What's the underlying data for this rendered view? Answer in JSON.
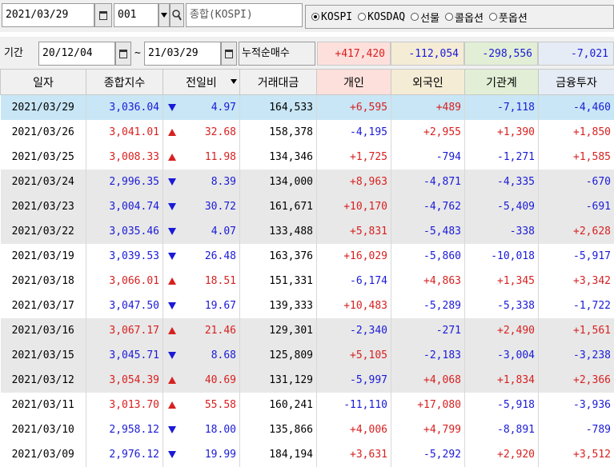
{
  "toolbar": {
    "date": "2021/03/29",
    "code": "001",
    "name": "종합(KOSPI)",
    "radios": [
      {
        "label": "KOSPI",
        "checked": true
      },
      {
        "label": "KOSDAQ",
        "checked": false
      },
      {
        "label": "선물",
        "checked": false
      },
      {
        "label": "콜옵션",
        "checked": false
      },
      {
        "label": "풋옵션",
        "checked": false
      }
    ]
  },
  "period": {
    "label": "기간",
    "from": "20/12/04",
    "tilde": "~",
    "to": "21/03/29",
    "cumulative_label": "누적순매수",
    "sums": {
      "individual": "+417,420",
      "foreign": "-112,054",
      "institution": "-298,556",
      "financial": "-7,021"
    }
  },
  "colors": {
    "up": "#d82020",
    "down": "#1a1ad8",
    "individual_bg": "#fde0dc",
    "foreign_bg": "#f5ecd6",
    "institution_bg": "#e2efd6",
    "financial_bg": "#e6ecf5",
    "selected": "#c8e6f5"
  },
  "columns": [
    "일자",
    "종합지수",
    "전일비",
    "거래대금",
    "개인",
    "외국인",
    "기관계",
    "금융투자"
  ],
  "rows": [
    {
      "date": "2021/03/29",
      "index": "3,036.04",
      "dir": "down",
      "change": "4.97",
      "amount": "164,533",
      "individual": "+6,595",
      "foreign": "+489",
      "institution": "-7,118",
      "financial": "-4,460"
    },
    {
      "date": "2021/03/26",
      "index": "3,041.01",
      "dir": "up",
      "change": "32.68",
      "amount": "158,378",
      "individual": "-4,195",
      "foreign": "+2,955",
      "institution": "+1,390",
      "financial": "+1,850"
    },
    {
      "date": "2021/03/25",
      "index": "3,008.33",
      "dir": "up",
      "change": "11.98",
      "amount": "134,346",
      "individual": "+1,725",
      "foreign": "-794",
      "institution": "-1,271",
      "financial": "+1,585"
    },
    {
      "date": "2021/03/24",
      "index": "2,996.35",
      "dir": "down",
      "change": "8.39",
      "amount": "134,000",
      "individual": "+8,963",
      "foreign": "-4,871",
      "institution": "-4,335",
      "financial": "-670"
    },
    {
      "date": "2021/03/23",
      "index": "3,004.74",
      "dir": "down",
      "change": "30.72",
      "amount": "161,671",
      "individual": "+10,170",
      "foreign": "-4,762",
      "institution": "-5,409",
      "financial": "-691"
    },
    {
      "date": "2021/03/22",
      "index": "3,035.46",
      "dir": "down",
      "change": "4.07",
      "amount": "133,488",
      "individual": "+5,831",
      "foreign": "-5,483",
      "institution": "-338",
      "financial": "+2,628"
    },
    {
      "date": "2021/03/19",
      "index": "3,039.53",
      "dir": "down",
      "change": "26.48",
      "amount": "163,376",
      "individual": "+16,029",
      "foreign": "-5,860",
      "institution": "-10,018",
      "financial": "-5,917"
    },
    {
      "date": "2021/03/18",
      "index": "3,066.01",
      "dir": "up",
      "change": "18.51",
      "amount": "151,331",
      "individual": "-6,174",
      "foreign": "+4,863",
      "institution": "+1,345",
      "financial": "+3,342"
    },
    {
      "date": "2021/03/17",
      "index": "3,047.50",
      "dir": "down",
      "change": "19.67",
      "amount": "139,333",
      "individual": "+10,483",
      "foreign": "-5,289",
      "institution": "-5,338",
      "financial": "-1,722"
    },
    {
      "date": "2021/03/16",
      "index": "3,067.17",
      "dir": "up",
      "change": "21.46",
      "amount": "129,301",
      "individual": "-2,340",
      "foreign": "-271",
      "institution": "+2,490",
      "financial": "+1,561"
    },
    {
      "date": "2021/03/15",
      "index": "3,045.71",
      "dir": "down",
      "change": "8.68",
      "amount": "125,809",
      "individual": "+5,105",
      "foreign": "-2,183",
      "institution": "-3,004",
      "financial": "-3,238"
    },
    {
      "date": "2021/03/12",
      "index": "3,054.39",
      "dir": "up",
      "change": "40.69",
      "amount": "131,129",
      "individual": "-5,997",
      "foreign": "+4,068",
      "institution": "+1,834",
      "financial": "+2,366"
    },
    {
      "date": "2021/03/11",
      "index": "3,013.70",
      "dir": "up",
      "change": "55.58",
      "amount": "160,241",
      "individual": "-11,110",
      "foreign": "+17,080",
      "institution": "-5,918",
      "financial": "-3,936"
    },
    {
      "date": "2021/03/10",
      "index": "2,958.12",
      "dir": "down",
      "change": "18.00",
      "amount": "135,866",
      "individual": "+4,006",
      "foreign": "+4,799",
      "institution": "-8,891",
      "financial": "-789"
    },
    {
      "date": "2021/03/09",
      "index": "2,976.12",
      "dir": "down",
      "change": "19.99",
      "amount": "184,194",
      "individual": "+3,631",
      "foreign": "-5,292",
      "institution": "+2,920",
      "financial": "+3,512"
    }
  ]
}
